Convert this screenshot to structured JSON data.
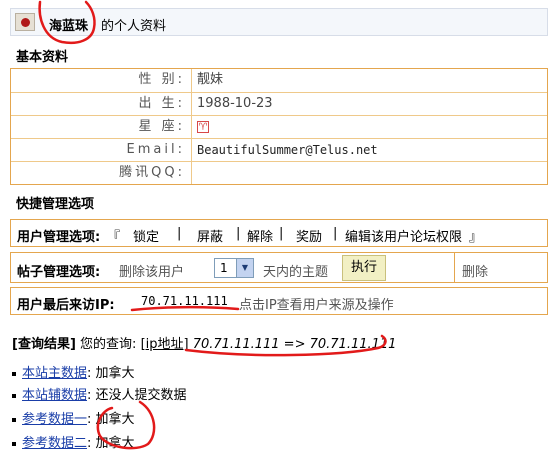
{
  "profile": {
    "username": "海蓝珠",
    "title_suffix": "的个人资料",
    "section_basic": "基本资料",
    "fields": [
      {
        "label": "性  别:",
        "value": "靓妹"
      },
      {
        "label": "出  生:",
        "value": "1988-10-23"
      },
      {
        "label": "星  座:",
        "value": "",
        "icon": "aries-zodiac-icon"
      },
      {
        "label": "Email:",
        "value": "BeautifulSummer@Telus.net"
      },
      {
        "label": "腾讯QQ:",
        "value": ""
      }
    ]
  },
  "admin": {
    "section_title": "快捷管理选项",
    "user_mgmt": {
      "label": "用户管理选项:",
      "open": "『",
      "actions": [
        "锁定",
        "屏蔽",
        "解除",
        "奖励",
        "编辑该用户论坛权限"
      ],
      "close": "』"
    },
    "post_mgmt": {
      "label": "帖子管理选项:",
      "delete_text": "删除该用户",
      "days_value": "1",
      "topics_text": "天内的主题",
      "exec_label": "执行",
      "overflow_text": "删除"
    },
    "last_ip": {
      "label": "用户最后来访IP:",
      "ip": "70.71.11.111",
      "hint": "点击IP查看用户来源及操作"
    }
  },
  "query": {
    "result_label": "[查询结果]",
    "your_query": "您的查询:",
    "query_type": "[ip地址]",
    "query_text": "70.71.11.111 => 70.71.11.111",
    "items": [
      {
        "key": "本站主数据",
        "value": ": 加拿大"
      },
      {
        "key": "本站辅数据",
        "value": ": 还没人提交数据"
      },
      {
        "key": "参考数据一",
        "value": ": 加拿大"
      },
      {
        "key": "参考数据二",
        "value": ": 加拿大"
      }
    ]
  },
  "colors": {
    "panel_border": "#e4a64e",
    "link": "#1a3ea8",
    "annotation": "#e21a1a"
  }
}
